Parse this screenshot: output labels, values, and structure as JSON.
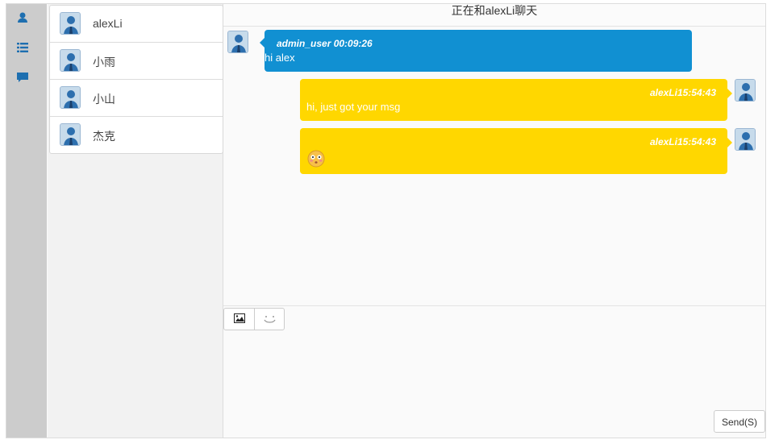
{
  "rail": {
    "icons": [
      "user-icon",
      "list-icon",
      "chat-bubble-icon"
    ]
  },
  "contacts": [
    {
      "name": "alexLi"
    },
    {
      "name": "小雨"
    },
    {
      "name": "小山"
    },
    {
      "name": "杰克"
    }
  ],
  "chat": {
    "title": "正在和alexLi聊天",
    "messages": [
      {
        "sender": "admin_user",
        "time": "00:09:26",
        "meta": "admin_user 00:09:26",
        "text": "hi alex",
        "side": "left",
        "color": "#1190d2"
      },
      {
        "sender": "alexLi",
        "time": "15:54:43",
        "meta": "alexLi15:54:43",
        "text": "hi, just got your msg",
        "side": "right",
        "color": "#ffd700"
      },
      {
        "sender": "alexLi",
        "time": "15:54:43",
        "meta": "alexLi15:54:43",
        "text": "",
        "emoji": "flushed-face-emoji",
        "side": "right",
        "color": "#ffd700"
      }
    ]
  },
  "toolbar": {
    "image_icon": "image-icon",
    "emoji_icon": "smiley-icon"
  },
  "composer": {
    "value": "",
    "send_label": "Send(S)"
  },
  "colors": {
    "rail": "#cccccc",
    "blue_bubble": "#1190d2",
    "yellow_bubble": "#ffd700"
  }
}
